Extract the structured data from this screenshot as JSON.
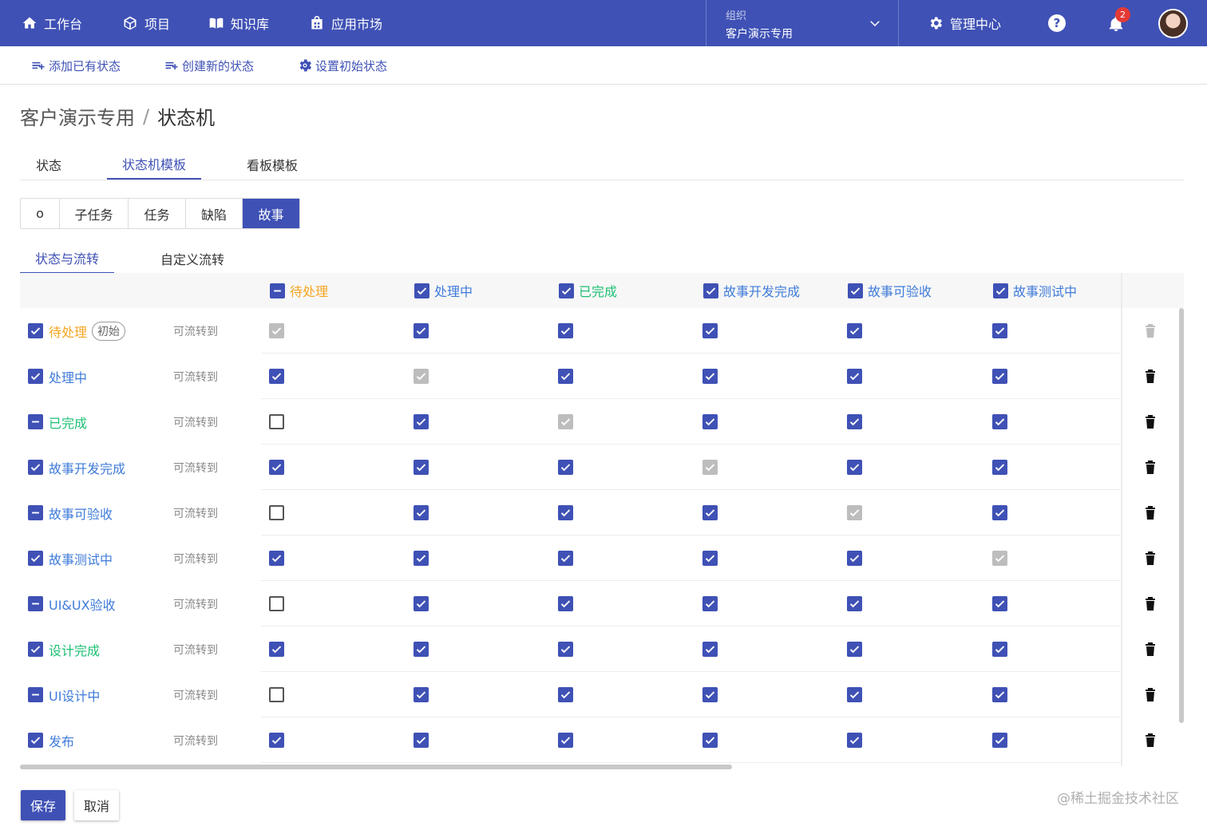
{
  "nav": {
    "items": [
      {
        "label": "工作台",
        "icon": "home-icon"
      },
      {
        "label": "项目",
        "icon": "cube-icon"
      },
      {
        "label": "知识库",
        "icon": "book-icon"
      },
      {
        "label": "应用市场",
        "icon": "store-icon"
      }
    ],
    "org_caption": "组织",
    "org_value": "客户演示专用",
    "admin_label": "管理中心",
    "help_glyph": "?",
    "notification_count": "2"
  },
  "actions": [
    {
      "label": "添加已有状态"
    },
    {
      "label": "创建新的状态"
    },
    {
      "label": "设置初始状态"
    }
  ],
  "breadcrumb": {
    "parent": "客户演示专用",
    "separator": "/",
    "current": "状态机"
  },
  "main_tabs": [
    {
      "label": "状态",
      "active": false
    },
    {
      "label": "状态机模板",
      "active": true
    },
    {
      "label": "看板模板",
      "active": false
    }
  ],
  "issue_types": [
    {
      "label": "o",
      "active": false
    },
    {
      "label": "子任务",
      "active": false
    },
    {
      "label": "任务",
      "active": false
    },
    {
      "label": "缺陷",
      "active": false
    },
    {
      "label": "故事",
      "active": true
    }
  ],
  "sub_tabs": [
    {
      "label": "状态与流转",
      "active": true
    },
    {
      "label": "自定义流转",
      "active": false
    }
  ],
  "colors": {
    "primary": "#3f51b5",
    "todo": "#f5a623",
    "doing": "#3f7bd9",
    "done": "#1dbf73",
    "disabled": "#bdbdbd"
  },
  "columns": [
    {
      "label": "待处理",
      "color": "todo",
      "check": "indet"
    },
    {
      "label": "处理中",
      "color": "doing",
      "check": "checked"
    },
    {
      "label": "已完成",
      "color": "done",
      "check": "checked"
    },
    {
      "label": "故事开发完成",
      "color": "doing",
      "check": "checked"
    },
    {
      "label": "故事可验收",
      "color": "doing",
      "check": "checked"
    },
    {
      "label": "故事测试中",
      "color": "doing",
      "check": "checked"
    }
  ],
  "row_hint": "可流转到",
  "initial_tag": "初始",
  "rows": [
    {
      "label": "待处理",
      "color": "todo",
      "check": "checked",
      "initial": true,
      "cells": [
        "disabled",
        "checked",
        "checked",
        "checked",
        "checked",
        "checked"
      ],
      "delete_disabled": true
    },
    {
      "label": "处理中",
      "color": "doing",
      "check": "checked",
      "initial": false,
      "cells": [
        "checked",
        "disabled",
        "checked",
        "checked",
        "checked",
        "checked"
      ],
      "delete_disabled": false
    },
    {
      "label": "已完成",
      "color": "done",
      "check": "indet",
      "initial": false,
      "cells": [
        "empty",
        "checked",
        "disabled",
        "checked",
        "checked",
        "checked"
      ],
      "delete_disabled": false
    },
    {
      "label": "故事开发完成",
      "color": "doing",
      "check": "checked",
      "initial": false,
      "cells": [
        "checked",
        "checked",
        "checked",
        "disabled",
        "checked",
        "checked"
      ],
      "delete_disabled": false
    },
    {
      "label": "故事可验收",
      "color": "doing",
      "check": "indet",
      "initial": false,
      "cells": [
        "empty",
        "checked",
        "checked",
        "checked",
        "disabled",
        "checked"
      ],
      "delete_disabled": false
    },
    {
      "label": "故事测试中",
      "color": "doing",
      "check": "checked",
      "initial": false,
      "cells": [
        "checked",
        "checked",
        "checked",
        "checked",
        "checked",
        "disabled"
      ],
      "delete_disabled": false
    },
    {
      "label": "UI&UX验收",
      "color": "doing",
      "check": "indet",
      "initial": false,
      "cells": [
        "empty",
        "checked",
        "checked",
        "checked",
        "checked",
        "checked"
      ],
      "delete_disabled": false
    },
    {
      "label": "设计完成",
      "color": "done",
      "check": "checked",
      "initial": false,
      "cells": [
        "checked",
        "checked",
        "checked",
        "checked",
        "checked",
        "checked"
      ],
      "delete_disabled": false
    },
    {
      "label": "UI设计中",
      "color": "doing",
      "check": "indet",
      "initial": false,
      "cells": [
        "empty",
        "checked",
        "checked",
        "checked",
        "checked",
        "checked"
      ],
      "delete_disabled": false
    },
    {
      "label": "发布",
      "color": "doing",
      "check": "checked",
      "initial": false,
      "cells": [
        "checked",
        "checked",
        "checked",
        "checked",
        "checked",
        "checked"
      ],
      "delete_disabled": false
    }
  ],
  "footer": {
    "save_label": "保存",
    "cancel_label": "取消"
  },
  "watermark": "@稀土掘金技术社区"
}
